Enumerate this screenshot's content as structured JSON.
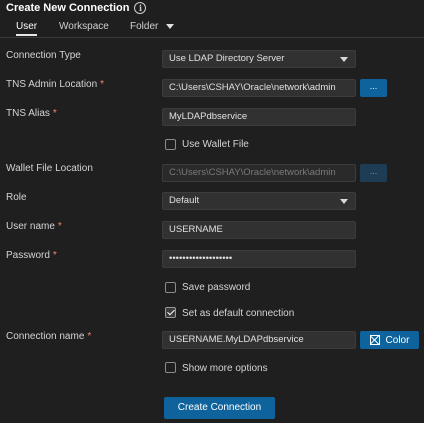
{
  "header": {
    "title": "Create New Connection",
    "info_icon": "info-icon"
  },
  "tabs": [
    {
      "label": "User",
      "active": true
    },
    {
      "label": "Workspace",
      "active": false
    },
    {
      "label": "Folder",
      "active": false
    }
  ],
  "form": {
    "connection_type": {
      "label": "Connection Type",
      "value": "Use LDAP Directory Server"
    },
    "tns_admin_location": {
      "label": "TNS Admin Location",
      "value": "C:\\Users\\CSHAY\\Oracle\\network\\admin",
      "browse_label": "..."
    },
    "tns_alias": {
      "label": "TNS Alias",
      "value": "MyLDAPdbservice"
    },
    "use_wallet_file": {
      "label": "Use Wallet File",
      "checked": false
    },
    "wallet_file_location": {
      "label": "Wallet File Location",
      "value": "C:\\Users\\CSHAY\\Oracle\\network\\admin",
      "browse_label": "..."
    },
    "role": {
      "label": "Role",
      "value": "Default"
    },
    "user_name": {
      "label": "User name",
      "value": "USERNAME"
    },
    "password": {
      "label": "Password",
      "value": "•••••••••••••••••••"
    },
    "save_password": {
      "label": "Save password",
      "checked": false
    },
    "set_default": {
      "label": "Set as default connection",
      "checked": true
    },
    "connection_name": {
      "label": "Connection name",
      "value": "USERNAME.MyLDAPdbservice",
      "color_label": "Color"
    },
    "show_more": {
      "label": "Show more options",
      "checked": false
    },
    "required_marker": "*"
  },
  "actions": {
    "create_label": "Create Connection"
  },
  "colors": {
    "background": "#1f1f1f",
    "primary": "#0e639c",
    "required": "#f48771"
  }
}
